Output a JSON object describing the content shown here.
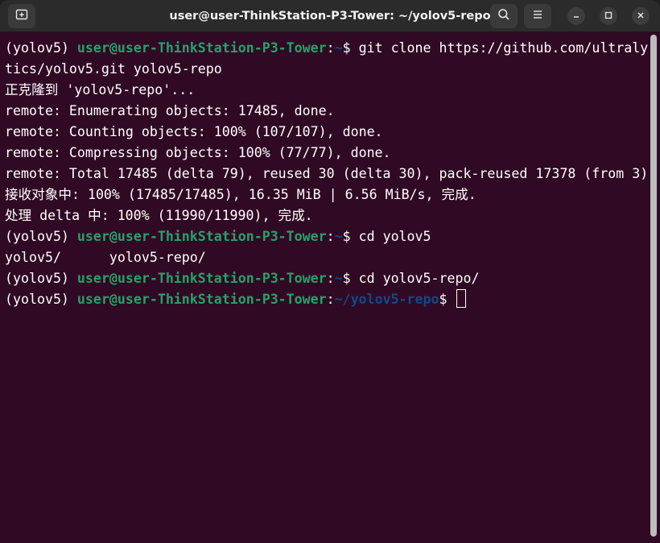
{
  "window": {
    "title": "user@user-ThinkStation-P3-Tower: ~/yolov5-repo"
  },
  "icons": {
    "new_tab": "new-tab-icon",
    "search": "search-icon",
    "menu": "hamburger-menu-icon",
    "minimize": "minimize-icon",
    "maximize": "maximize-icon",
    "close": "close-icon"
  },
  "colors": {
    "terminal_bg": "#300a24",
    "titlebar_bg": "#2b2b2b",
    "user_host": "#26a269",
    "path": "#12488b",
    "text": "#ffffff"
  },
  "terminal": {
    "lines": [
      {
        "type": "prompt",
        "env": "(yolov5) ",
        "user": "user@user-ThinkStation-P3-Tower",
        "sep": ":",
        "path": "~",
        "sym": "$ ",
        "cmd": "git clone https://github.com/ultraly"
      },
      {
        "type": "text",
        "text": "tics/yolov5.git yolov5-repo"
      },
      {
        "type": "text",
        "text": "正克隆到 'yolov5-repo'..."
      },
      {
        "type": "text",
        "text": "remote: Enumerating objects: 17485, done."
      },
      {
        "type": "text",
        "text": "remote: Counting objects: 100% (107/107), done."
      },
      {
        "type": "text",
        "text": "remote: Compressing objects: 100% (77/77), done."
      },
      {
        "type": "text",
        "text": "remote: Total 17485 (delta 79), reused 30 (delta 30), pack-reused 17378 (from 3)"
      },
      {
        "type": "text",
        "text": "接收对象中: 100% (17485/17485), 16.35 MiB | 6.56 MiB/s, 完成."
      },
      {
        "type": "text",
        "text": "处理 delta 中: 100% (11990/11990), 完成."
      },
      {
        "type": "prompt",
        "env": "(yolov5) ",
        "user": "user@user-ThinkStation-P3-Tower",
        "sep": ":",
        "path": "~",
        "sym": "$ ",
        "cmd": "cd yolov5"
      },
      {
        "type": "text",
        "text": "yolov5/      yolov5-repo/"
      },
      {
        "type": "prompt",
        "env": "(yolov5) ",
        "user": "user@user-ThinkStation-P3-Tower",
        "sep": ":",
        "path": "~",
        "sym": "$ ",
        "cmd": "cd yolov5-repo/"
      },
      {
        "type": "prompt",
        "env": "(yolov5) ",
        "user": "user@user-ThinkStation-P3-Tower",
        "sep": ":",
        "path": "~/yolov5-repo",
        "sym": "$ ",
        "cmd": ""
      }
    ]
  }
}
